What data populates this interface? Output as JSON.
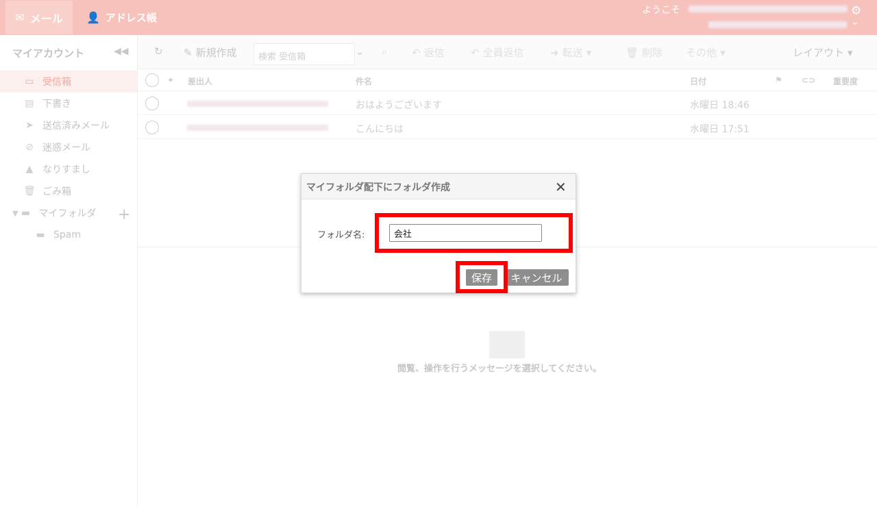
{
  "topbar": {
    "mail_tab": "メール",
    "address_tab": "アドレス帳",
    "welcome": "ようこそ"
  },
  "sidebar": {
    "title": "マイアカウント",
    "items": [
      {
        "label": "受信箱",
        "icon": "inbox-icon",
        "active": true
      },
      {
        "label": "下書き",
        "icon": "draft-icon"
      },
      {
        "label": "送信済みメール",
        "icon": "sent-icon"
      },
      {
        "label": "迷惑メール",
        "icon": "spam-icon"
      },
      {
        "label": "なりすまし",
        "icon": "warning-icon"
      },
      {
        "label": "ごみ箱",
        "icon": "trash-icon"
      },
      {
        "label": "マイフォルダ",
        "icon": "folder-icon"
      },
      {
        "label": "Spam",
        "icon": "folder-icon"
      }
    ]
  },
  "toolbar": {
    "new": "新規作成",
    "search_placeholder": "検索 受信箱",
    "reply": "返信",
    "reply_all": "全員返信",
    "forward": "転送",
    "delete": "削除",
    "other": "その他",
    "layout": "レイアウト"
  },
  "list": {
    "columns": {
      "sender": "差出人",
      "subject": "件名",
      "date": "日付",
      "priority": "重要度"
    },
    "rows": [
      {
        "subject": "おはようございます",
        "date": "水曜日 18:46"
      },
      {
        "subject": "こんにちは",
        "date": "水曜日 17:51"
      }
    ]
  },
  "preview": {
    "empty_text": "閲覧、操作を行うメッセージを選択してください。"
  },
  "dialog": {
    "title": "マイフォルダ配下にフォルダ作成",
    "label": "フォルダ名:",
    "input_value": "会社",
    "save": "保存",
    "cancel": "キャンセル"
  },
  "colors": {
    "header": "#f8c2bc",
    "accent": "#f3a79e",
    "highlight": "#ff0000",
    "button": "#8e8e8e"
  }
}
